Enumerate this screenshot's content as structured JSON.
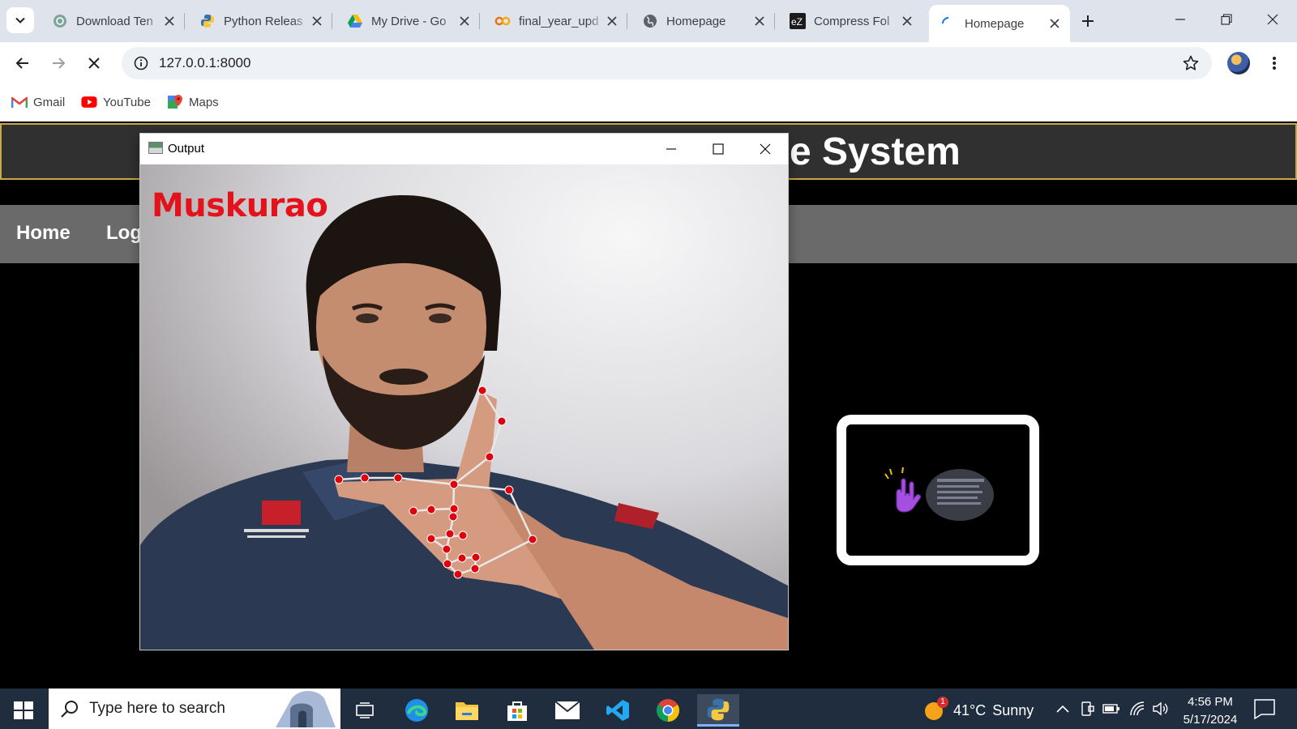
{
  "browser": {
    "tabs": [
      {
        "title": "Download Ten",
        "icon": "chatgpt-icon",
        "active": false
      },
      {
        "title": "Python Releas",
        "icon": "python-icon",
        "active": false
      },
      {
        "title": "My Drive - Go",
        "icon": "google-drive-icon",
        "active": false
      },
      {
        "title": "final_year_upd",
        "icon": "colab-icon",
        "active": false
      },
      {
        "title": "Homepage",
        "icon": "globe-icon",
        "active": false
      },
      {
        "title": "Compress Fol",
        "icon": "ezyzip-icon",
        "active": false
      },
      {
        "title": "Homepage",
        "icon": "loading-spinner-icon",
        "active": true
      }
    ],
    "url": "127.0.0.1:8000",
    "bookmarks": [
      {
        "label": "Gmail",
        "icon": "gmail-icon"
      },
      {
        "label": "YouTube",
        "icon": "youtube-icon"
      },
      {
        "label": "Maps",
        "icon": "maps-icon"
      }
    ]
  },
  "page": {
    "header_title": "e System",
    "nav": [
      "Home",
      "Log"
    ]
  },
  "output_window": {
    "title": "Output",
    "detected_gesture": "Muskurao"
  },
  "taskbar": {
    "search_placeholder": "Type here to search",
    "weather": {
      "badge": "1",
      "temperature": "41°C",
      "condition": "Sunny"
    },
    "clock": {
      "time": "4:56 PM",
      "date": "5/17/2024"
    }
  },
  "colors": {
    "tab_strip": "#dfe3eb",
    "site_header": "#303030",
    "nav_bar": "#6a6a6a",
    "gesture_text": "#e3121b",
    "landmark_dot": "#e0000b",
    "taskbar": "#1f2d3e"
  }
}
